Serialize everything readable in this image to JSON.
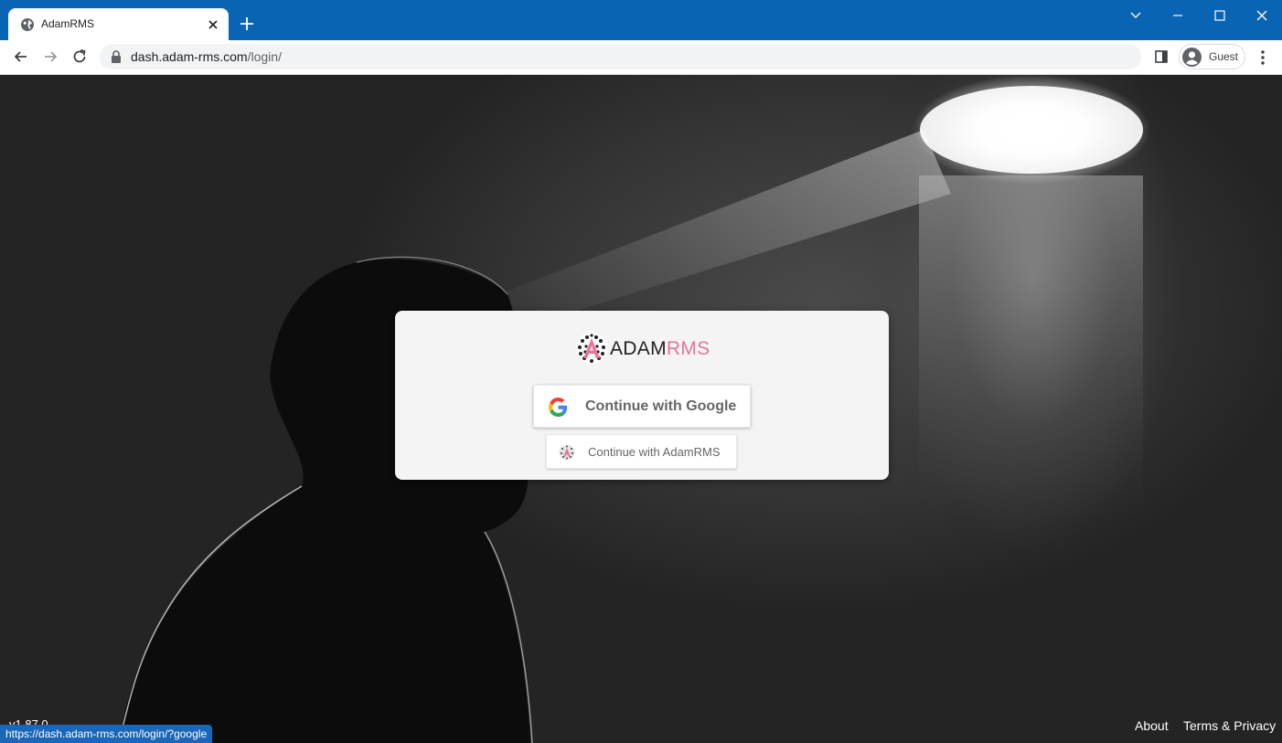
{
  "browser": {
    "tab": {
      "title": "AdamRMS",
      "favicon": "globe-icon"
    },
    "address_bar": {
      "host": "dash.adam-rms.com",
      "path": "/login/"
    },
    "profile_label": "Guest",
    "status_url": "https://dash.adam-rms.com/login/?google",
    "colors": {
      "titlebar": "#0a64b4"
    }
  },
  "login": {
    "logo_text_dark": "ADAM",
    "logo_text_accent": "RMS",
    "google_button_label": "Continue with Google",
    "adamrms_button_label": "Continue with AdamRMS",
    "colors": {
      "accent": "#e8749a"
    }
  },
  "footer": {
    "version": "v1.87.0",
    "about": "About",
    "terms": "Terms & Privacy"
  }
}
